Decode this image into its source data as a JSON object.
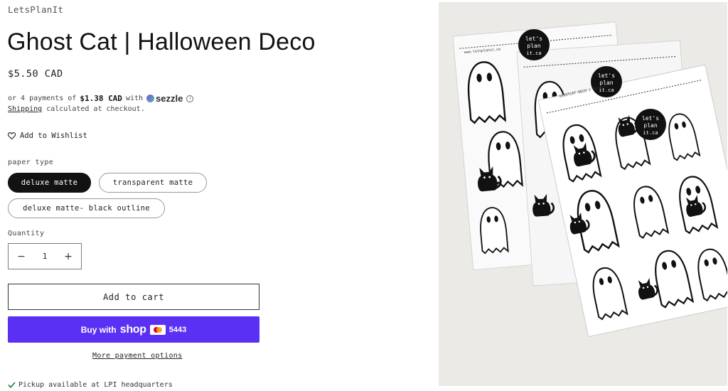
{
  "product": {
    "vendor": "LetsPlanIt",
    "title": "Ghost Cat | Halloween Deco",
    "price": "$5.50 CAD"
  },
  "installments": {
    "prefix": "or 4 payments of",
    "amount": "$1.38 CAD",
    "with": "with",
    "provider": "sezzle",
    "info": "i"
  },
  "shipping": {
    "link": "Shipping",
    "rest": "calculated at checkout."
  },
  "wishlist": {
    "label": "Add to Wishlist"
  },
  "paper_type": {
    "label": "paper type",
    "options": [
      "deluxe matte",
      "transparent matte",
      "deluxe matte- black outline"
    ],
    "selected": "deluxe matte"
  },
  "quantity": {
    "label": "Quantity",
    "value": "1",
    "minus": "−",
    "plus": "+"
  },
  "buttons": {
    "add_to_cart": "Add to cart",
    "buy_with": "Buy with",
    "shop": "shop",
    "card_last4": "5443",
    "more_payment": "More payment options"
  },
  "pickup": {
    "text": "Pickup available at LPI headquarters"
  },
  "photo": {
    "sticker_badge": [
      "let's",
      "plan",
      "it.ca"
    ],
    "sheet_header": "www.letsplanit.ca",
    "sheet_code": "GHOSTCAT DECO | DECO011"
  },
  "colors": {
    "accent": "#5a31f4",
    "selected_pill": "#121212",
    "text": "#121212"
  }
}
